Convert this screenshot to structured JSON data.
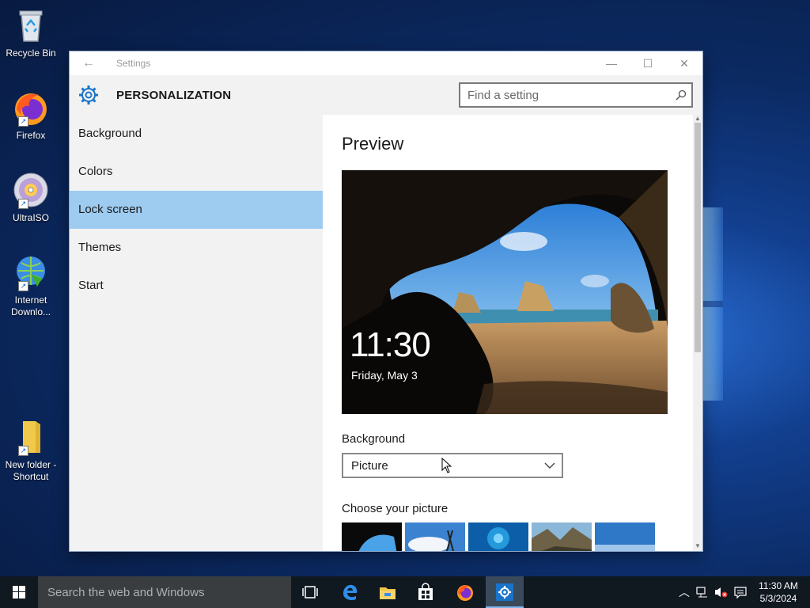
{
  "desktop": {
    "icons": [
      {
        "label": "Recycle Bin"
      },
      {
        "label": "Firefox"
      },
      {
        "label": "UltraISO"
      },
      {
        "label": "Internet Downlo..."
      },
      {
        "label": "New folder - Shortcut"
      }
    ]
  },
  "window": {
    "title": "Settings",
    "section_title": "PERSONALIZATION",
    "search_placeholder": "Find a setting",
    "nav": [
      {
        "label": "Background",
        "active": false
      },
      {
        "label": "Colors",
        "active": false
      },
      {
        "label": "Lock screen",
        "active": true
      },
      {
        "label": "Themes",
        "active": false
      },
      {
        "label": "Start",
        "active": false
      }
    ],
    "content": {
      "preview_title": "Preview",
      "preview_time": "11:30",
      "preview_date": "Friday, May 3",
      "background_label": "Background",
      "background_value": "Picture",
      "choose_label": "Choose your picture"
    }
  },
  "taskbar": {
    "search_placeholder": "Search the web and Windows",
    "clock_time": "11:30 AM",
    "clock_date": "5/3/2024"
  },
  "colors": {
    "accent": "#9ecbf0",
    "taskbar": "#101820"
  }
}
